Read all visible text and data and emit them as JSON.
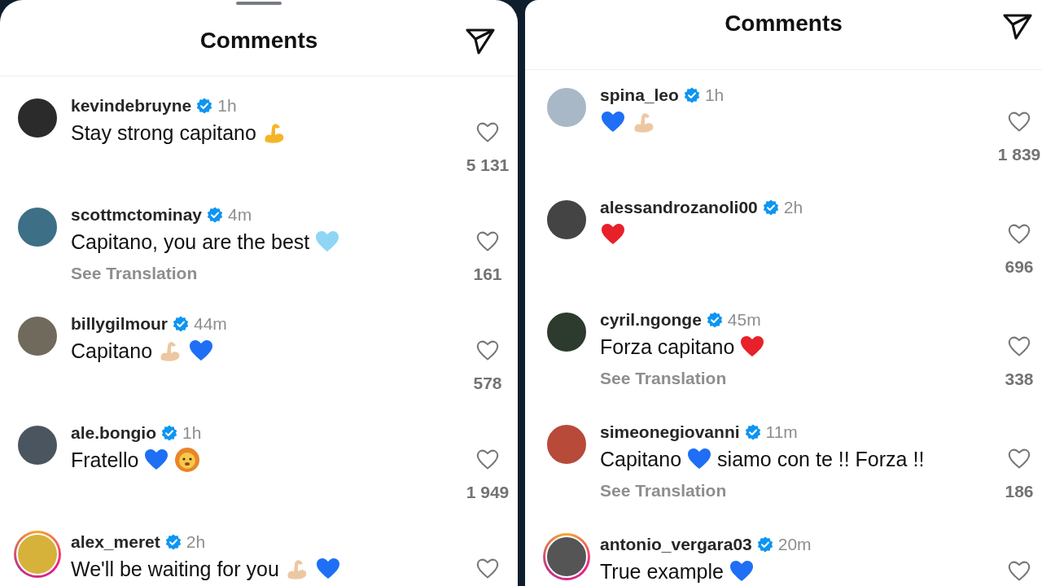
{
  "panels": [
    {
      "title": "Comments",
      "drag_handle": true,
      "comments": [
        {
          "username": "kevindebruyne",
          "verified": true,
          "time": "1h",
          "parts": [
            {
              "kind": "text",
              "text": "Stay strong capitano"
            },
            {
              "kind": "biceps",
              "color": "#f5b52a"
            }
          ],
          "likes": "5 131"
        },
        {
          "username": "scottmctominay",
          "verified": true,
          "time": "4m",
          "parts": [
            {
              "kind": "text",
              "text": "Capitano, you are the best"
            },
            {
              "kind": "heart",
              "color": "#8fd6f5"
            }
          ],
          "translation": "See Translation",
          "likes": "161"
        },
        {
          "username": "billygilmour",
          "verified": true,
          "time": "44m",
          "parts": [
            {
              "kind": "text",
              "text": "Capitano"
            },
            {
              "kind": "biceps",
              "color": "#ecc8a2"
            },
            {
              "kind": "heart",
              "color": "#1e6ff5"
            }
          ],
          "likes": "578"
        },
        {
          "username": "ale.bongio",
          "verified": true,
          "time": "1h",
          "parts": [
            {
              "kind": "text",
              "text": "Fratello"
            },
            {
              "kind": "heart",
              "color": "#1e6ff5"
            },
            {
              "kind": "lion"
            }
          ],
          "likes": "1 949"
        },
        {
          "username": "alex_meret",
          "verified": true,
          "time": "2h",
          "story_ring": true,
          "parts": [
            {
              "kind": "text",
              "text": "We'll be waiting for you"
            },
            {
              "kind": "biceps",
              "color": "#ecc8a2"
            },
            {
              "kind": "heart",
              "color": "#1e6ff5"
            }
          ]
        }
      ]
    },
    {
      "title": "Comments",
      "comments": [
        {
          "username": "spina_leo",
          "verified": true,
          "time": "1h",
          "parts": [
            {
              "kind": "heart",
              "color": "#1e6ff5"
            },
            {
              "kind": "biceps",
              "color": "#ecc8a2"
            }
          ],
          "likes": "1 839"
        },
        {
          "username": "alessandrozanoli00",
          "verified": true,
          "time": "2h",
          "parts": [
            {
              "kind": "heart",
              "color": "#e8202a"
            }
          ],
          "likes": "696"
        },
        {
          "username": "cyril.ngonge",
          "verified": true,
          "time": "45m",
          "parts": [
            {
              "kind": "text",
              "text": "Forza capitano"
            },
            {
              "kind": "heart",
              "color": "#e8202a"
            }
          ],
          "translation": "See Translation",
          "likes": "338"
        },
        {
          "username": "simeonegiovanni",
          "verified": true,
          "time": "11m",
          "parts": [
            {
              "kind": "text",
              "text": "Capitano"
            },
            {
              "kind": "heart",
              "color": "#1e6ff5"
            },
            {
              "kind": "text",
              "text": "siamo con te !! Forza !!"
            }
          ],
          "translation": "See Translation",
          "likes": "186"
        },
        {
          "username": "antonio_vergara03",
          "verified": true,
          "time": "20m",
          "story_ring": true,
          "parts": [
            {
              "kind": "text",
              "text": "True example"
            },
            {
              "kind": "heart",
              "color": "#1e6ff5"
            }
          ]
        }
      ]
    }
  ]
}
